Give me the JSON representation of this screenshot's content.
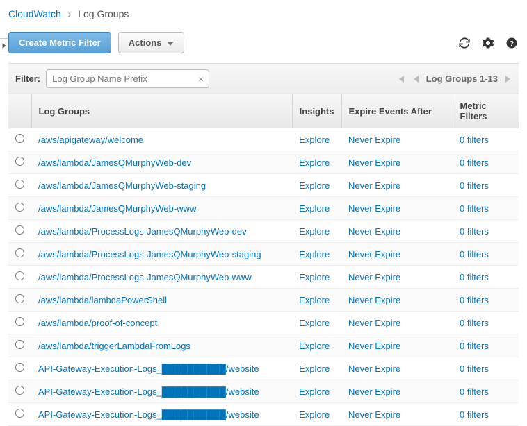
{
  "breadcrumb": {
    "service": "CloudWatch",
    "page": "Log Groups"
  },
  "toolbar": {
    "create_label": "Create Metric Filter",
    "actions_label": "Actions"
  },
  "filter": {
    "label": "Filter:",
    "placeholder": "Log Group Name Prefix"
  },
  "pager": {
    "range_label": "Log Groups 1-13"
  },
  "table": {
    "headers": {
      "name": "Log Groups",
      "insights": "Insights",
      "expire": "Expire Events After",
      "filters": "Metric Filters"
    },
    "insights_label": "Explore",
    "expire_label": "Never Expire",
    "filters_label": "0 filters",
    "rows": [
      {
        "name": "/aws/apigateway/welcome"
      },
      {
        "name": "/aws/lambda/JamesQMurphyWeb-dev"
      },
      {
        "name": "/aws/lambda/JamesQMurphyWeb-staging"
      },
      {
        "name": "/aws/lambda/JamesQMurphyWeb-www"
      },
      {
        "name": "/aws/lambda/ProcessLogs-JamesQMurphyWeb-dev"
      },
      {
        "name": "/aws/lambda/ProcessLogs-JamesQMurphyWeb-staging"
      },
      {
        "name": "/aws/lambda/ProcessLogs-JamesQMurphyWeb-www"
      },
      {
        "name": "/aws/lambda/lambdaPowerShell"
      },
      {
        "name": "/aws/lambda/proof-of-concept"
      },
      {
        "name": "/aws/lambda/triggerLambdaFromLogs"
      },
      {
        "name": "API-Gateway-Execution-Logs_██████████/website"
      },
      {
        "name": "API-Gateway-Execution-Logs_██████████/website"
      },
      {
        "name": "API-Gateway-Execution-Logs_██████████/website"
      }
    ]
  }
}
